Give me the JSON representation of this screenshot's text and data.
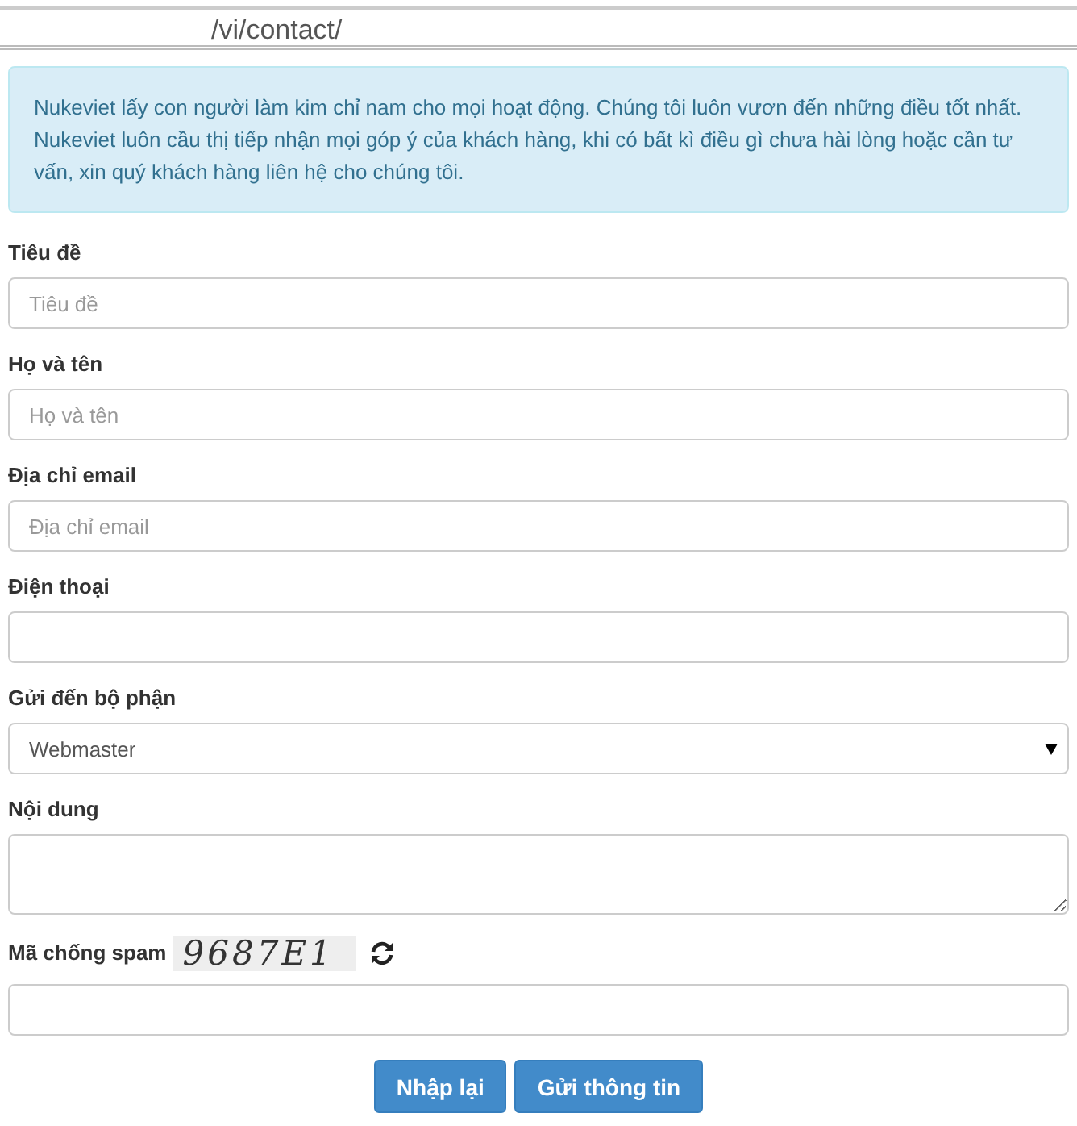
{
  "address_bar": {
    "url": "/vi/contact/"
  },
  "notice": "Nukeviet lấy con người làm kim chỉ nam cho mọi hoạt động. Chúng tôi luôn vươn đến những điều tốt nhất. Nukeviet luôn cầu thị tiếp nhận mọi góp ý của khách hàng, khi có bất kì điều gì chưa hài lòng hoặc cần tư vấn, xin quý khách hàng liên hệ cho chúng tôi.",
  "fields": [
    {
      "kind": "input",
      "label": "Tiêu đề",
      "placeholder": "Tiêu đề"
    },
    {
      "kind": "input",
      "label": "Họ và tên",
      "placeholder": "Họ và tên"
    },
    {
      "kind": "input",
      "label": "Địa chỉ email",
      "placeholder": "Địa chỉ email"
    },
    {
      "kind": "input",
      "label": "Điện thoại"
    },
    {
      "kind": "select",
      "label": "Gửi đến bộ phận",
      "value": "Webmaster"
    },
    {
      "kind": "textarea",
      "label": "Nội dung"
    }
  ],
  "captcha": {
    "label": "Mã chống spam",
    "code": "9687E1"
  },
  "buttons": [
    "Nhập lại",
    "Gửi thông tin"
  ]
}
